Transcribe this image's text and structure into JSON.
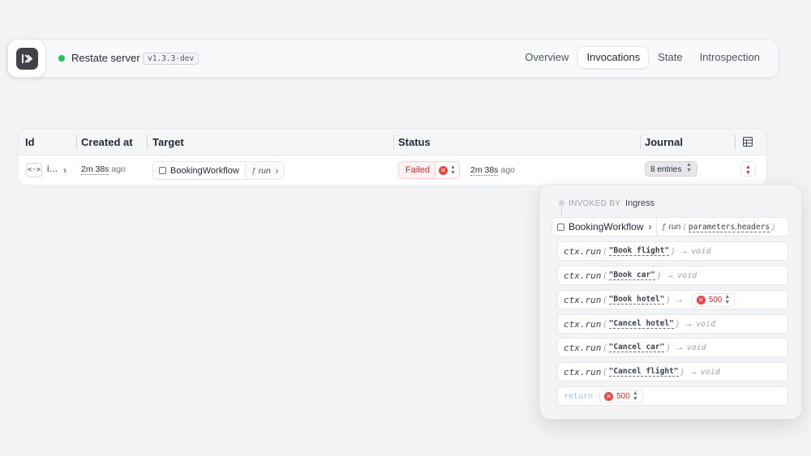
{
  "header": {
    "server_name": "Restate server",
    "version": "v1.3.3-dev",
    "tabs": [
      {
        "label": "Overview"
      },
      {
        "label": "Invocations"
      },
      {
        "label": "State"
      },
      {
        "label": "Introspection"
      }
    ],
    "active_tab": "Invocations",
    "status_color": "#22c55e"
  },
  "table": {
    "columns": [
      "Id",
      "Created at",
      "Target",
      "Status",
      "Journal"
    ],
    "row": {
      "id_icon": "<·>",
      "id": "i…",
      "created_time": "2m 38s",
      "created_suffix": "ago",
      "target_service": "BookingWorkflow",
      "target_handler": "run",
      "status": "Failed",
      "status_time": "2m 38s",
      "status_suffix": "ago",
      "journal": "8 entries"
    }
  },
  "popover": {
    "invoked_label": "INVOKED BY",
    "invoked_by": "Ingress",
    "service": "BookingWorkflow",
    "handler": "run",
    "params": [
      "parameters",
      "headers"
    ],
    "param_sep": ",",
    "entries": [
      {
        "fn": "ctx.run",
        "arg": "\"Book flight\"",
        "ret": "void"
      },
      {
        "fn": "ctx.run",
        "arg": "\"Book car\"",
        "ret": "void"
      },
      {
        "fn": "ctx.run",
        "arg": "\"Book hotel\"",
        "ret": "500"
      },
      {
        "fn": "ctx.run",
        "arg": "\"Cancel hotel\"",
        "ret": "void"
      },
      {
        "fn": "ctx.run",
        "arg": "\"Cancel car\"",
        "ret": "void"
      },
      {
        "fn": "ctx.run",
        "arg": "\"Cancel flight\"",
        "ret": "void"
      }
    ],
    "return_label": "return",
    "return_value": "500",
    "error_color": "#ef4444"
  }
}
